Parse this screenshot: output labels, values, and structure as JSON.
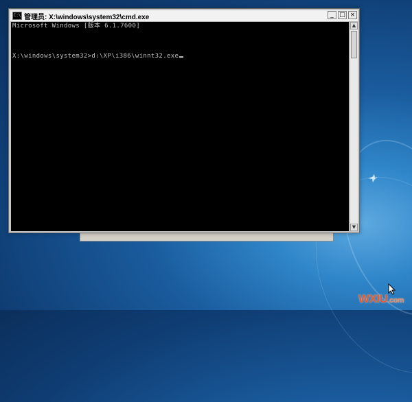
{
  "window": {
    "title": "管理员: X:\\windows\\system32\\cmd.exe",
    "icon": "cmd-icon",
    "controls": {
      "minimize": "_",
      "maximize": "□",
      "close": "×"
    }
  },
  "console": {
    "lines": [
      "Microsoft Windows [版本 6.1.7600]",
      "X:\\windows\\system32>d:\\XP\\i386\\winnt32.exe"
    ]
  },
  "scrollbar": {
    "up": "▲",
    "down": "▼"
  },
  "watermark": {
    "brand": "WXIU",
    "suffix": ".com"
  },
  "colors": {
    "console_bg": "#000000",
    "console_fg": "#c0c0c0",
    "watermark": "#e95b2b"
  }
}
